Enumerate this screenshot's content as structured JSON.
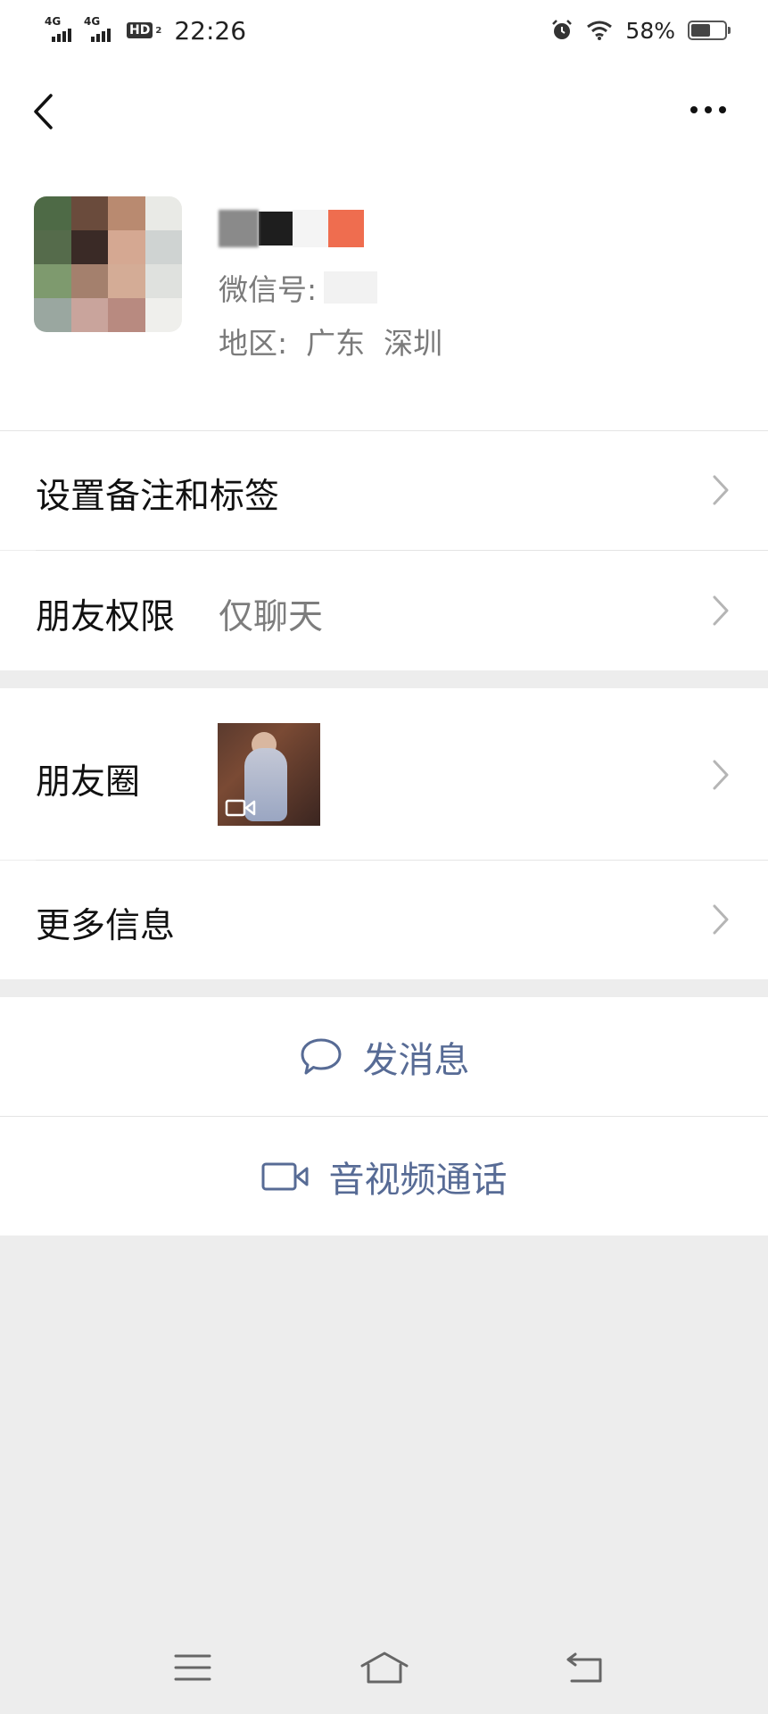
{
  "status_bar": {
    "signal1_label": "4G",
    "signal2_label": "4G",
    "hd_label": "HD",
    "hd_sub": "2",
    "time": "22:26",
    "battery_percent": "58%",
    "battery_level": 0.58,
    "icons": [
      "alarm-icon",
      "wifi-icon",
      "battery-icon"
    ]
  },
  "nav": {
    "back_icon": "chevron-left-icon",
    "more_icon": "more-dots-icon"
  },
  "profile": {
    "wechat_id_label": "微信号:",
    "region_text": "地区:  广东  深圳"
  },
  "rows": {
    "remark_label": "设置备注和标签",
    "permission_label": "朋友权限",
    "permission_value": "仅聊天",
    "moments_label": "朋友圈",
    "more_info_label": "更多信息"
  },
  "actions": {
    "message_label": "发消息",
    "message_icon": "chat-bubble-icon",
    "call_label": "音视频通话",
    "call_icon": "video-camera-icon"
  },
  "system_nav": {
    "icons": [
      "menu-icon",
      "home-icon",
      "back-icon"
    ]
  },
  "colors": {
    "link_blue": "#576b95",
    "background_gray": "#ededed",
    "secondary_text": "#7d7d7d"
  }
}
